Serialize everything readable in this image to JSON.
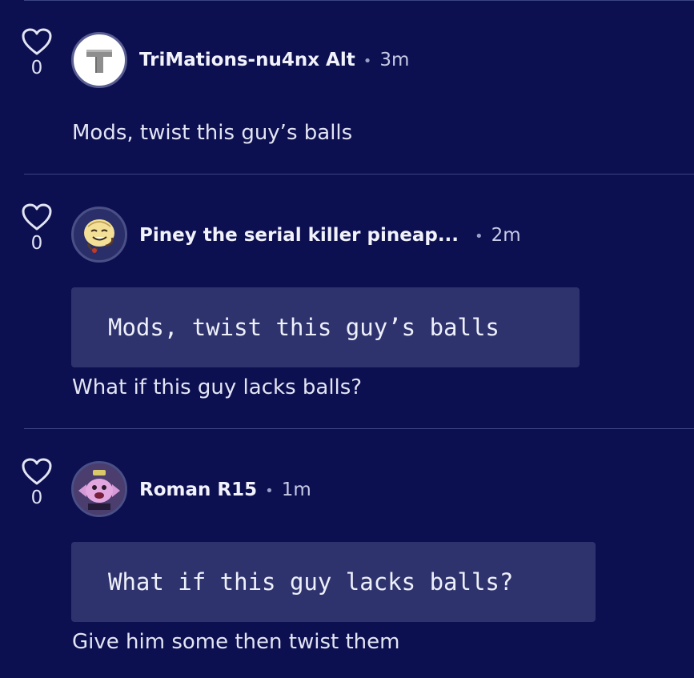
{
  "comments": [
    {
      "likes": "0",
      "username": "TriMations-nu4nx Alt",
      "time": "3m",
      "avatar_icon": "letter-t-logo-icon",
      "quote": "",
      "text": "Mods, twist this guy’s balls"
    },
    {
      "likes": "0",
      "username": "Piney the serial killer pineap...",
      "time": "2m",
      "avatar_icon": "pineapple-character-avatar",
      "quote": "Mods, twist this guy’s balls",
      "text": "What if this guy lacks balls?"
    },
    {
      "likes": "0",
      "username": "Roman R15",
      "time": "1m",
      "avatar_icon": "pink-candy-character-avatar",
      "quote": "What if this guy lacks balls?",
      "text": "Give him some then twist them"
    }
  ],
  "separator": "•",
  "colors": {
    "background": "#0c0f50",
    "quote_background": "#2e336e",
    "divider": "#3d4585"
  }
}
